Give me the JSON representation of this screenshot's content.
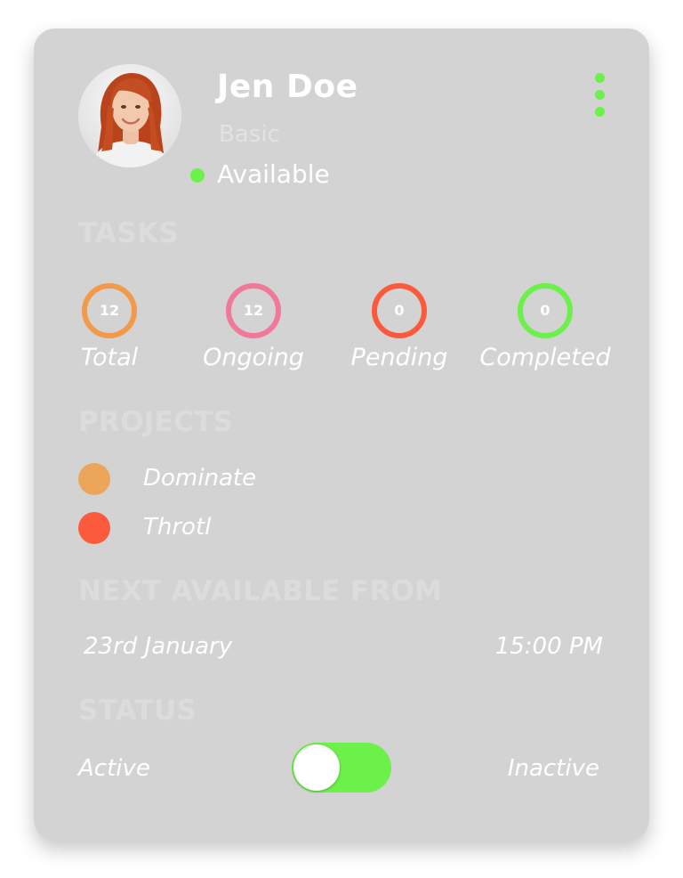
{
  "profile": {
    "name": "Jen Doe",
    "plan": "Basic",
    "availability": "Available"
  },
  "menu": {
    "icon": "kebab-menu-icon"
  },
  "tasks": {
    "heading": "TASKS",
    "items": [
      {
        "label": "Total",
        "count": "12",
        "color": "#f29a4a"
      },
      {
        "label": "Ongoing",
        "count": "12",
        "color": "#f0799a"
      },
      {
        "label": "Pending",
        "count": "0",
        "color": "#fb5b3c"
      },
      {
        "label": "Completed",
        "count": "0",
        "color": "#6cf04a"
      }
    ]
  },
  "projects": {
    "heading": "PROJECTS",
    "items": [
      {
        "name": "Dominate",
        "color": "#eba65a"
      },
      {
        "name": "Throtl",
        "color": "#fb5b3c"
      }
    ]
  },
  "next_available": {
    "heading": "NEXT AVAILABLE FROM",
    "date": "23rd January",
    "time": "15:00 PM"
  },
  "status": {
    "heading": "STATUS",
    "left_label": "Active",
    "right_label": "Inactive",
    "toggle_color": "#6cf04a"
  },
  "colors": {
    "card_bg": "#d3d3d3",
    "accent_green": "#6cf04a"
  }
}
